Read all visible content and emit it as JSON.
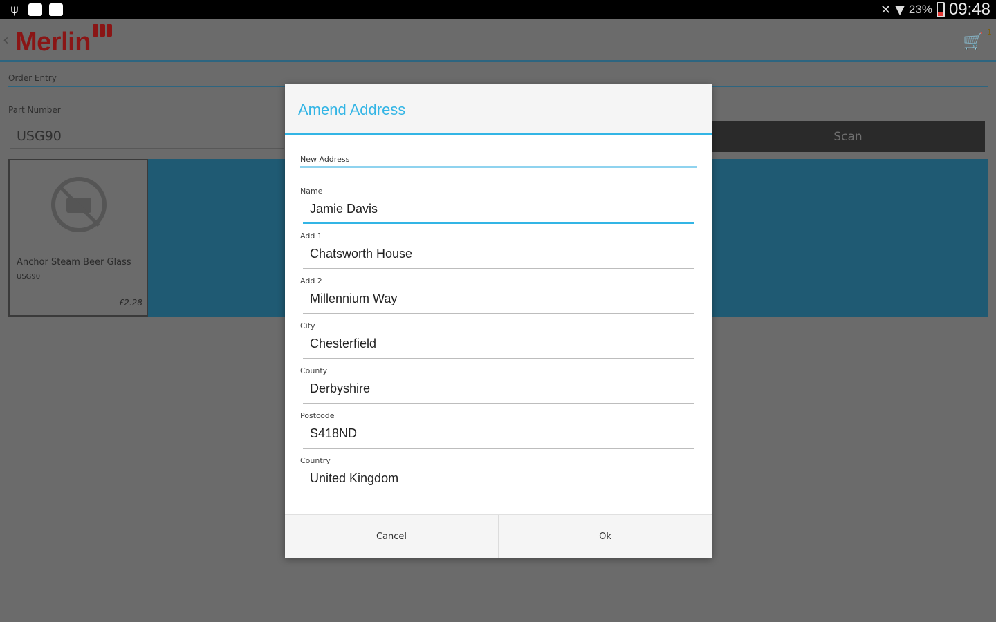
{
  "status_bar": {
    "left_icons": [
      "usb-icon",
      "screenshot-icon",
      "briefcase-icon"
    ],
    "battery_percent": "23%",
    "time": "09:48"
  },
  "app": {
    "logo_text": "Merlin",
    "section_label": "Order Entry",
    "part_number_label": "Part Number",
    "part_number_value": "USG90",
    "scan_label": "Scan",
    "cart_count": "1"
  },
  "product": {
    "name": "Anchor Steam Beer Glass",
    "code": "USG90",
    "price": "£2.28"
  },
  "dialog": {
    "title": "Amend Address",
    "section_label": "New Address",
    "fields": [
      {
        "label": "Name",
        "value": "Jamie Davis"
      },
      {
        "label": "Add 1",
        "value": "Chatsworth House"
      },
      {
        "label": "Add 2",
        "value": "Millennium Way"
      },
      {
        "label": "City",
        "value": "Chesterfield"
      },
      {
        "label": "County",
        "value": "Derbyshire"
      },
      {
        "label": "Postcode",
        "value": "S418ND"
      },
      {
        "label": "Country",
        "value": "United Kingdom"
      }
    ],
    "cancel_label": "Cancel",
    "ok_label": "Ok"
  },
  "colors": {
    "accent": "#33b5e5",
    "brand": "#c62828",
    "band": "#1f5a73"
  }
}
